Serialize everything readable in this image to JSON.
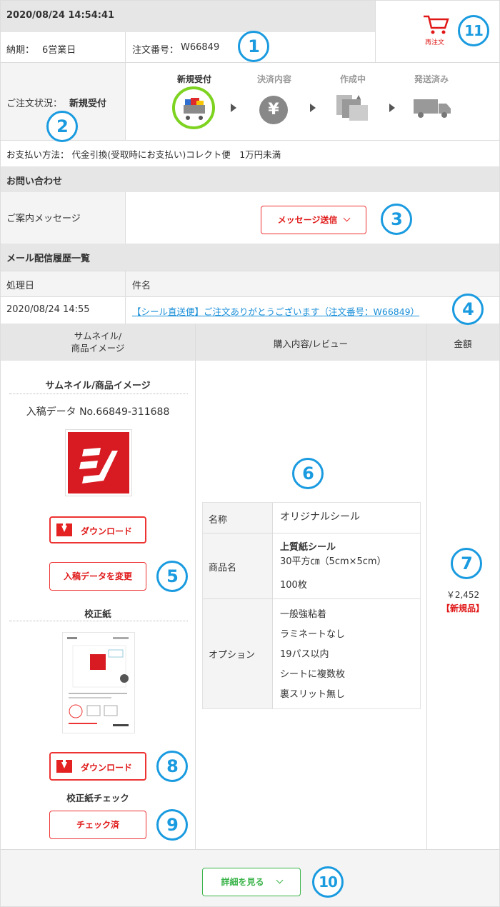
{
  "header": {
    "datetime": "2020/08/24 14:54:41",
    "delivery_label": "納期：",
    "delivery_value": "6営業日",
    "order_label": "注文番号：",
    "order_value": "W66849",
    "reorder_label": "再注文"
  },
  "status": {
    "label": "ご注文状況：",
    "value": "新規受付",
    "steps": [
      "新規受付",
      "決済内容",
      "作成中",
      "発送済み"
    ]
  },
  "payment": {
    "text": "お支払い方法： 代金引換(受取時にお支払い)コレクト便　1万円未満"
  },
  "inquiry": {
    "title": "お問い合わせ",
    "message_label": "ご案内メッセージ",
    "send_button": "メッセージ送信"
  },
  "mail_history": {
    "title": "メール配信履歴一覧",
    "col_date": "処理日",
    "col_subject": "件名",
    "rows": [
      {
        "date": "2020/08/24 14:55",
        "subject": "【シール直送便】ご注文ありがとうございます（注文番号：W66849）"
      }
    ]
  },
  "items_table": {
    "col_thumb": "サムネイル/\n商品イメージ",
    "col_content": "購入内容/レビュー",
    "col_price": "金額",
    "thumb_title": "サムネイル/商品イメージ",
    "data_no": "入稿データ No.66849-311688",
    "download_label": "ダウンロード",
    "change_data_button": "入稿データを変更",
    "proof_title": "校正紙",
    "proof_download_label": "ダウンロード",
    "proof_check_title": "校正紙チェック",
    "checked_button": "チェック済",
    "details": {
      "name_label": "名称",
      "name_value": "オリジナルシール",
      "product_label": "商品名",
      "product_bold": "上質紙シール",
      "product_size": "30平方㎝（5cm×5cm）",
      "product_qty": "100枚",
      "option_label": "オプション",
      "options": [
        "一般強粘着",
        "ラミネートなし",
        "19パス以内",
        "シートに複数枚",
        "裏スリット無し"
      ]
    },
    "price": "￥2,452",
    "price_badge": "【新規品】"
  },
  "footer": {
    "details_button": "詳細を見る"
  },
  "markers": [
    "1",
    "2",
    "3",
    "4",
    "5",
    "6",
    "7",
    "8",
    "9",
    "10",
    "11"
  ],
  "colors": {
    "marker": "#1a9be0",
    "red": "#e01818",
    "green": "#3cb44b",
    "link": "#1a8fd8",
    "header_gray": "#e6e6e6"
  }
}
